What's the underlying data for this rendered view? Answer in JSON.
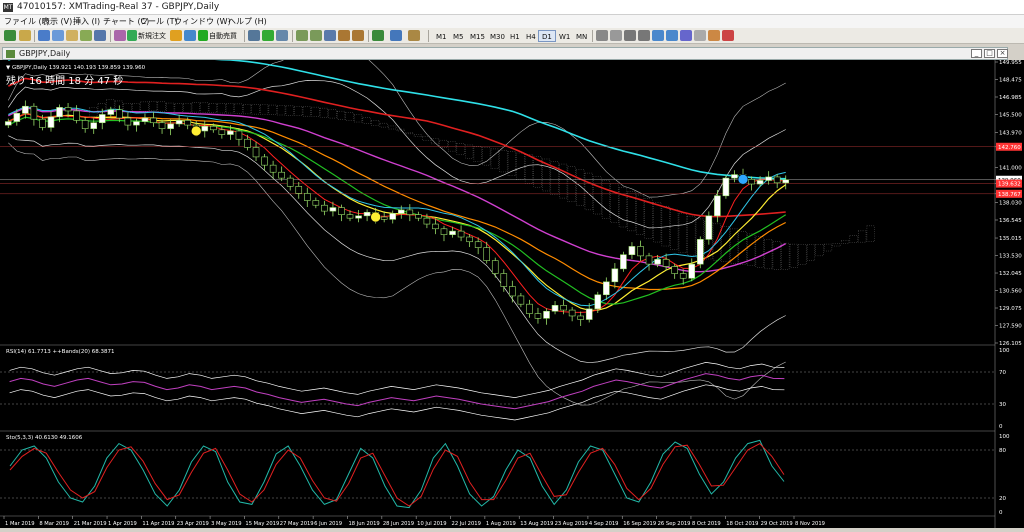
{
  "window": {
    "title": "47010157: XMTrading-Real 37 - GBPJPY,Daily",
    "app_icon": "mt4-app-icon"
  },
  "menu": [
    "ファイル (F)",
    "表示 (V)",
    "挿入 (I)",
    "チャート (C)",
    "ツール (T)",
    "ウィンドウ (W)",
    "ヘルプ (H)"
  ],
  "toolbar": {
    "new_order_label": "新規注文",
    "auto_trade_label": "自動売買",
    "timeframes": [
      "M1",
      "M5",
      "M15",
      "M30",
      "H1",
      "H4",
      "D1",
      "W1",
      "MN"
    ],
    "active_timeframe": "D1"
  },
  "chart_window": {
    "tab_label": "GBPJPY,Daily",
    "header": "▼ GBPJPY,Daily  139.921 140.193 139.859 139.960",
    "countdown": "残り 16 時間 18 分 47 秒",
    "bg_color": "#000000",
    "price_label_color": "#ff3333"
  },
  "chart_data": [
    {
      "type": "candlestick",
      "title": "GBPJPY,Daily",
      "ohlc_current": {
        "open": 139.921,
        "high": 140.193,
        "low": 139.859,
        "close": 139.96
      },
      "y_ticks": [
        "149.955",
        "148.475",
        "146.985",
        "145.500",
        "143.970",
        "142.760",
        "141.000",
        "139.960",
        "139.632",
        "138.767",
        "138.030",
        "136.545",
        "135.015",
        "133.530",
        "132.045",
        "130.560",
        "129.075",
        "127.590",
        "126.105"
      ],
      "price_labels": [
        {
          "value": "142.760",
          "style": "red"
        },
        {
          "value": "139.960",
          "style": "white"
        },
        {
          "value": "139.632",
          "style": "red"
        },
        {
          "value": "138.767",
          "style": "red"
        }
      ],
      "ylim": [
        126.105,
        149.955
      ],
      "x_ticks": [
        "1 Mar 2019",
        "8 Mar 2019",
        "21 Mar 2019",
        "1 Apr 2019",
        "11 Apr 2019",
        "23 Apr 2019",
        "3 May 2019",
        "15 May 2019",
        "27 May 2019",
        "6 Jun 2019",
        "18 Jun 2019",
        "28 Jun 2019",
        "10 Jul 2019",
        "22 Jul 2019",
        "1 Aug 2019",
        "13 Aug 2019",
        "23 Aug 2019",
        "4 Sep 2019",
        "16 Sep 2019",
        "26 Sep 2019",
        "8 Oct 2019",
        "18 Oct 2019",
        "29 Oct 2019",
        "8 Nov 2019"
      ],
      "close_path": [
        144.9,
        145.6,
        146.2,
        145.1,
        144.4,
        145.3,
        146.1,
        145.8,
        145.0,
        144.3,
        144.8,
        145.5,
        145.9,
        145.2,
        144.6,
        144.9,
        145.2,
        144.8,
        144.3,
        144.7,
        145.0,
        144.6,
        144.1,
        144.5,
        144.2,
        143.8,
        144.1,
        143.4,
        142.7,
        141.9,
        141.2,
        140.6,
        140.1,
        139.4,
        138.8,
        138.2,
        137.8,
        137.3,
        137.6,
        137.0,
        136.7,
        136.9,
        137.2,
        136.8,
        136.6,
        137.1,
        137.4,
        137.0,
        136.7,
        136.2,
        135.8,
        135.3,
        135.6,
        135.1,
        134.7,
        134.2,
        133.1,
        132.0,
        130.9,
        130.1,
        129.4,
        128.6,
        128.2,
        128.8,
        129.3,
        128.9,
        128.4,
        128.1,
        129.0,
        130.2,
        131.3,
        132.4,
        133.6,
        134.3,
        133.5,
        132.8,
        133.2,
        132.6,
        132.0,
        131.6,
        132.8,
        134.9,
        136.9,
        138.6,
        140.1,
        140.4,
        140.0,
        139.6,
        139.9,
        140.2,
        139.7,
        139.96
      ],
      "indicators": [
        {
          "name": "MA cyan",
          "color": "#2fe0e8"
        },
        {
          "name": "MA red",
          "color": "#e02020"
        },
        {
          "name": "MA magenta",
          "color": "#d040d0"
        },
        {
          "name": "MA orange",
          "color": "#ff8c00"
        },
        {
          "name": "MA yellow",
          "color": "#ffee33"
        },
        {
          "name": "MA green",
          "color": "#22c022"
        },
        {
          "name": "Bollinger Bands",
          "color": "#ffffff"
        },
        {
          "name": "Ichimoku cloud",
          "color": "#cccccc"
        }
      ]
    },
    {
      "type": "line",
      "title": "RSI(14) 61.7713  ++Bands(20) 68.3871",
      "ylim": [
        0,
        100
      ],
      "y_ticks": [
        "100",
        "70",
        "30",
        "0"
      ],
      "rsi": [
        58,
        62,
        60,
        55,
        52,
        56,
        60,
        62,
        58,
        54,
        55,
        58,
        57,
        52,
        48,
        50,
        54,
        52,
        48,
        50,
        52,
        50,
        45,
        42,
        38,
        35,
        32,
        34,
        36,
        33,
        30,
        28,
        32,
        35,
        38,
        36,
        34,
        37,
        40,
        38,
        36,
        33,
        30,
        28,
        26,
        24,
        27,
        30,
        33,
        38,
        42,
        46,
        52,
        56,
        60,
        58,
        55,
        52,
        50,
        55,
        60,
        64,
        68,
        66,
        62,
        60,
        64,
        66,
        62,
        61.8
      ]
    },
    {
      "type": "line",
      "title": "Sto(5,3,3) 40.6130 49.1606",
      "ylim": [
        0,
        100
      ],
      "y_ticks": [
        "100",
        "80",
        "20",
        "0"
      ],
      "main": [
        60,
        80,
        85,
        70,
        40,
        20,
        15,
        35,
        70,
        88,
        80,
        55,
        25,
        10,
        30,
        65,
        85,
        78,
        40,
        15,
        12,
        40,
        75,
        85,
        60,
        30,
        12,
        18,
        50,
        82,
        70,
        35,
        10,
        8,
        30,
        70,
        88,
        60,
        25,
        10,
        22,
        55,
        80,
        70,
        35,
        12,
        30,
        65,
        85,
        80,
        50,
        20,
        15,
        40,
        75,
        90,
        82,
        50,
        25,
        40,
        70,
        88,
        92,
        60,
        40.6
      ],
      "signal": [
        55,
        72,
        82,
        76,
        52,
        30,
        20,
        28,
        58,
        80,
        84,
        66,
        38,
        18,
        24,
        52,
        76,
        82,
        55,
        25,
        15,
        30,
        62,
        80,
        70,
        42,
        20,
        16,
        38,
        70,
        76,
        48,
        20,
        10,
        22,
        56,
        80,
        72,
        40,
        18,
        18,
        42,
        70,
        76,
        48,
        22,
        24,
        52,
        76,
        82,
        62,
        32,
        18,
        32,
        62,
        84,
        86,
        62,
        35,
        36,
        58,
        80,
        88,
        72,
        49.2
      ]
    }
  ]
}
